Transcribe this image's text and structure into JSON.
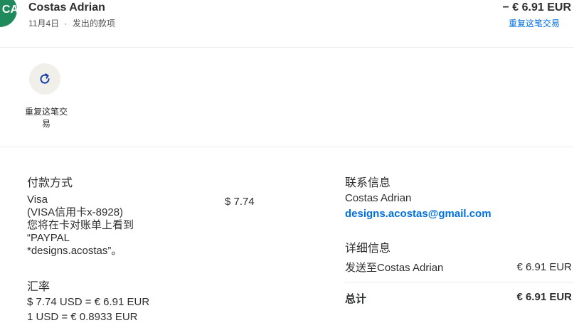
{
  "header": {
    "avatar_initials": "CA",
    "name": "Costas Adrian",
    "date": "11月4日",
    "separator": "·",
    "type": "发出的款项",
    "amount": "− € 6.91 EUR",
    "repeat_link": "重复这笔交易"
  },
  "actions": [
    {
      "label": "重复这笔交易",
      "icon": "refresh-icon"
    }
  ],
  "payment_method": {
    "title": "付款方式",
    "card_name": "Visa",
    "card_detail": "(VISA信用卡x-8928)",
    "statement_note_1": "您将在卡对账单上看到",
    "statement_note_2": "“PAYPAL",
    "statement_note_3": "*designs.acostas”。",
    "amount": "$ 7.74"
  },
  "exchange_rate": {
    "title": "汇率",
    "line1": "$ 7.74 USD = € 6.91 EUR",
    "line2": "1 USD = € 0.8933 EUR"
  },
  "contact": {
    "title": "联系信息",
    "name": "Costas Adrian",
    "email": "designs.acostas@gmail.com"
  },
  "details": {
    "title": "详细信息",
    "sent_to_label": "发送至Costas Adrian",
    "sent_to_amount": "€ 6.91 EUR",
    "total_label": "总计",
    "total_amount": "€ 6.91 EUR"
  },
  "colors": {
    "avatar_bg": "#1f8a5b",
    "link": "#0070e0",
    "action_bg": "#f1efea",
    "icon": "#1a3fa8"
  }
}
